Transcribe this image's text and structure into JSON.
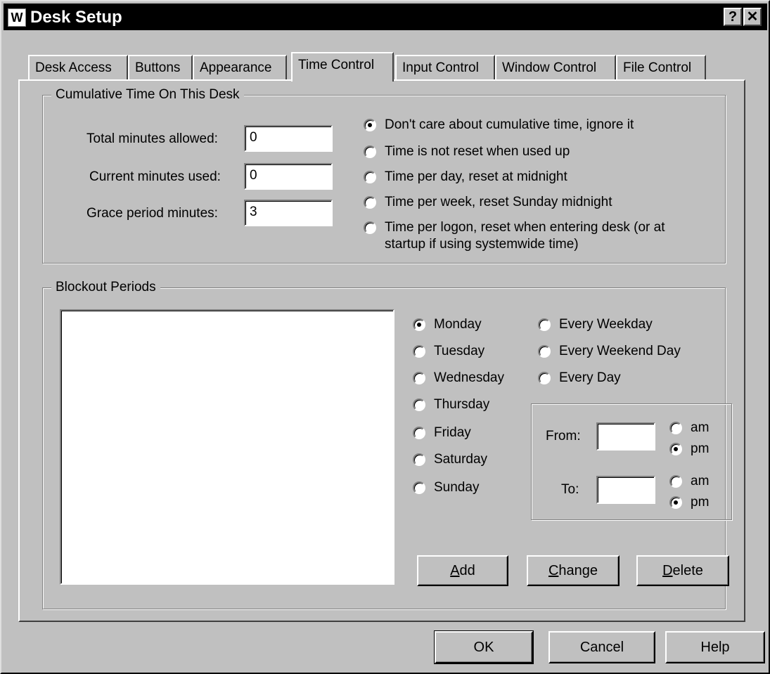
{
  "window": {
    "title": "Desk Setup",
    "app_icon_glyph": "W",
    "help_glyph": "?",
    "close_glyph": "✕"
  },
  "tabs": [
    {
      "label": "Desk Access"
    },
    {
      "label": "Buttons"
    },
    {
      "label": "Appearance"
    },
    {
      "label": "Time Control",
      "active": true
    },
    {
      "label": "Input Control"
    },
    {
      "label": "Window Control"
    },
    {
      "label": "File Control"
    }
  ],
  "cumulative": {
    "title": "Cumulative Time On This Desk",
    "total_label": "Total minutes allowed:",
    "total_value": "0",
    "current_label": "Current minutes used:",
    "current_value": "0",
    "grace_label": "Grace period minutes:",
    "grace_value": "3",
    "options": [
      {
        "label": "Don't care about cumulative time, ignore it",
        "checked": true
      },
      {
        "label": "Time is not reset when used up",
        "checked": false
      },
      {
        "label": "Time per day, reset at midnight",
        "checked": false
      },
      {
        "label": "Time per week, reset Sunday midnight",
        "checked": false
      },
      {
        "label": "Time per logon, reset when entering desk (or at",
        "label2": "startup if using systemwide time)",
        "checked": false
      }
    ]
  },
  "blockout": {
    "title": "Blockout Periods",
    "days": [
      {
        "label": "Monday",
        "checked": true
      },
      {
        "label": "Tuesday",
        "checked": false
      },
      {
        "label": "Wednesday",
        "checked": false
      },
      {
        "label": "Thursday",
        "checked": false
      },
      {
        "label": "Friday",
        "checked": false
      },
      {
        "label": "Saturday",
        "checked": false
      },
      {
        "label": "Sunday",
        "checked": false
      }
    ],
    "groups": [
      {
        "label": "Every Weekday",
        "checked": false
      },
      {
        "label": "Every Weekend Day",
        "checked": false
      },
      {
        "label": "Every Day",
        "checked": false
      }
    ],
    "from_label": "From:",
    "from_value": "",
    "to_label": "To:",
    "to_value": "",
    "from_am": {
      "label": "am",
      "checked": false
    },
    "from_pm": {
      "label": "pm",
      "checked": true
    },
    "to_am": {
      "label": "am",
      "checked": false
    },
    "to_pm": {
      "label": "pm",
      "checked": true
    },
    "add": {
      "mnemonic": "A",
      "rest": "dd"
    },
    "change": {
      "mnemonic": "C",
      "rest": "hange"
    },
    "delete": {
      "mnemonic": "D",
      "rest": "elete"
    }
  },
  "footer": {
    "ok": "OK",
    "cancel": "Cancel",
    "help": "Help"
  }
}
